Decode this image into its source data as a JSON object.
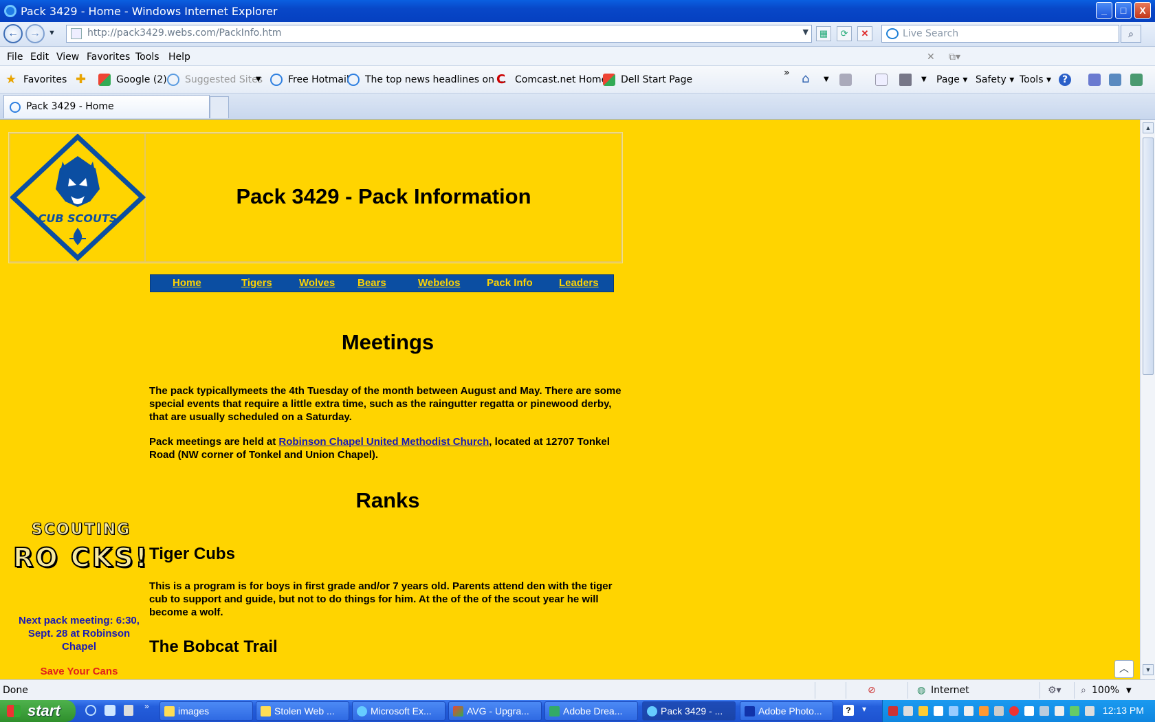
{
  "window": {
    "title": "Pack 3429 - Home - Windows Internet Explorer",
    "minimize": "_",
    "maximize": "□",
    "close": "X"
  },
  "address": {
    "url": "http://pack3429.webs.com/PackInfo.htm",
    "search_placeholder": "Live Search"
  },
  "menu": {
    "items": [
      "File",
      "Edit",
      "View",
      "Favorites",
      "Tools",
      "Help"
    ]
  },
  "favorites_bar": {
    "favorites": "Favorites",
    "items": [
      "Google (2)",
      "Suggested Sites",
      "Free Hotmail",
      "The top news headlines on ...",
      "Comcast.net Home",
      "Dell Start Page"
    ],
    "more": "»",
    "commands": [
      "Page",
      "Safety",
      "Tools"
    ]
  },
  "tab": {
    "label": "Pack 3429 - Home"
  },
  "page": {
    "title": "Pack 3429 - Pack Information",
    "nav": [
      "Home",
      "Tigers",
      "Wolves",
      "Bears",
      "Webelos",
      "Pack Info",
      "Leaders"
    ],
    "meetings_heading": "Meetings",
    "meetings_p1": "The pack typicallymeets the 4th Tuesday of the month between August and May. There are some special events that require a little extra time, such as the raingutter regatta or pinewood derby, that are usually scheduled on a Saturday.",
    "meetings_p2_pre": "Pack meetings are held at ",
    "meetings_p2_link": "Robinson Chapel United Methodist Church",
    "meetings_p2_post": ", located at 12707 Tonkel Road (NW corner of Tonkel and Union Chapel).",
    "ranks_heading": "Ranks",
    "tiger_heading": "Tiger Cubs",
    "tiger_p": "This is a program is for boys in first grade and/or 7 years old. Parents attend den with the tiger cub to support and guide, but not to do things for him. At the of the of the scout year he will become a wolf.",
    "bobcat_heading": "The Bobcat Trail",
    "logo_text": "CUB SCOUTS",
    "sidebar": {
      "rocks_line1": "SCOUTING",
      "rocks_line2": "RO CKS!",
      "next_meeting": "Next pack meeting: 6:30, Sept. 28 at Robinson Chapel",
      "save_cans": "Save Your Cans"
    }
  },
  "status": {
    "text": "Done",
    "zone": "Internet",
    "zoom": "100%"
  },
  "taskbar": {
    "start": "start",
    "buttons": [
      "images",
      "Stolen Web ...",
      "Microsoft Ex...",
      "AVG - Upgra...",
      "Adobe Drea...",
      "Pack 3429 - ...",
      "Adobe Photo..."
    ],
    "clock": "12:13 PM"
  },
  "colors": {
    "page_bg": "#ffd400",
    "nav_bg": "#0b4ea2",
    "link": "#1a1ab5",
    "alert": "#e0201a"
  }
}
